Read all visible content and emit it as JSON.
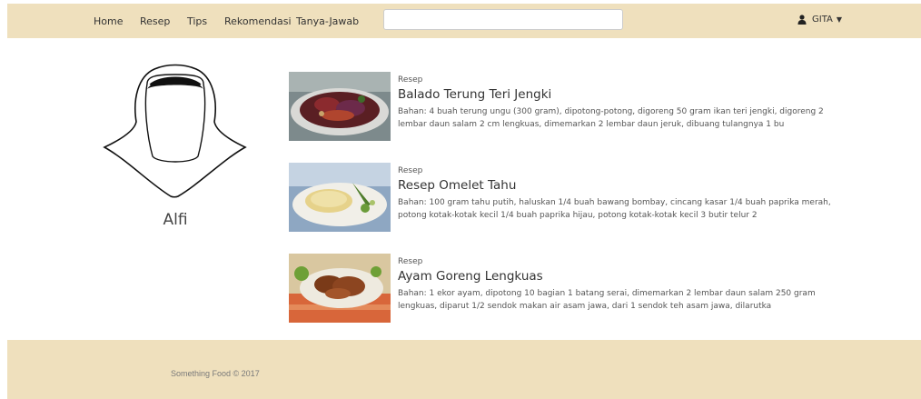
{
  "navbar": {
    "links": [
      "Home",
      "Resep",
      "Tips",
      "Rekomendasi",
      "Tanya-Jawab"
    ],
    "search": {
      "value": "",
      "placeholder": ""
    },
    "user": {
      "name": "GITA",
      "icon": "user-icon",
      "caret_icon": "caret-down-icon"
    }
  },
  "profile": {
    "name": "Alfi",
    "avatar_icon": "hijab-avatar-icon"
  },
  "posts": [
    {
      "category": "Resep",
      "title": "Balado Terung Teri Jengki",
      "description": "Bahan: 4 buah terung ungu (300 gram), dipotong-potong, digoreng 50 gram ikan teri jengki, digoreng 2 lembar daun salam  2 cm lengkuas, dimemarkan 2 lembar daun jeruk, dibuang tulangnya 1 bu"
    },
    {
      "category": "Resep",
      "title": "Resep Omelet Tahu",
      "description": "Bahan: 100 gram tahu putih, haluskan 1/4 buah bawang bombay, cincang kasar 1/4 buah paprika merah, potong kotak-kotak kecil 1/4 buah paprika hijau, potong kotak-kotak kecil 3 butir telur  2"
    },
    {
      "category": "Resep",
      "title": "Ayam Goreng Lengkuas",
      "description": "Bahan: 1 ekor ayam, dipotong 10 bagian 1 batang serai, dimemarkan  2 lembar daun salam  250 gram lengkuas, diparut 1/2 sendok makan air asam jawa, dari 1 sendok teh asam jawa, dilarutka"
    }
  ],
  "footer": {
    "copyright": "Something Food © 2017"
  },
  "colors": {
    "navbar_bg": "#efe0bd",
    "footer_bg": "#efe0bd"
  }
}
